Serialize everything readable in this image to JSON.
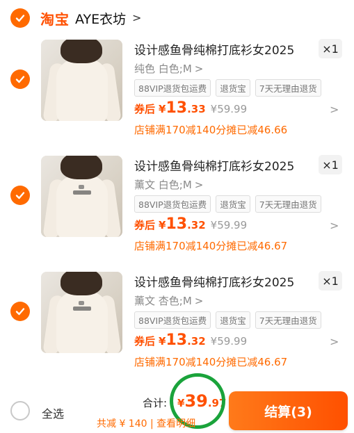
{
  "colors": {
    "accent": "#ff5000",
    "discount": "#ff6a00",
    "highlight_circle": "#1aa33b"
  },
  "store": {
    "brand": "淘宝",
    "name": "AYE衣坊",
    "chevron": ">"
  },
  "items": [
    {
      "title": "设计感鱼骨纯棉打底衫女2025",
      "qty": "×1",
      "variant": "纯色 白色;M",
      "tags": [
        "88VIP退货包运费",
        "退货宝",
        "7天无理由退货"
      ],
      "price_label": "券后",
      "price_symbol": "¥",
      "price_int": "13",
      "price_dec": ".33",
      "price_orig": "¥59.99",
      "discount_note": "店铺满170减140分摊已减46.66",
      "checked": true
    },
    {
      "title": "设计感鱼骨纯棉打底衫女2025",
      "qty": "×1",
      "variant": "薰文 白色;M",
      "tags": [
        "88VIP退货包运费",
        "退货宝",
        "7天无理由退货"
      ],
      "price_label": "券后",
      "price_symbol": "¥",
      "price_int": "13",
      "price_dec": ".32",
      "price_orig": "¥59.99",
      "discount_note": "店铺满170减140分摊已减46.67",
      "checked": true
    },
    {
      "title": "设计感鱼骨纯棉打底衫女2025",
      "qty": "×1",
      "variant": "薰文 杏色;M",
      "tags": [
        "88VIP退货包运费",
        "退货宝",
        "7天无理由退货"
      ],
      "price_label": "券后",
      "price_symbol": "¥",
      "price_int": "13",
      "price_dec": ".32",
      "price_orig": "¥59.99",
      "discount_note": "店铺满170减140分摊已减46.67",
      "checked": true
    }
  ],
  "footer": {
    "select_all": "全选",
    "total_label": "合计:",
    "total_symbol": "¥",
    "total_int": "39",
    "total_dec": ".97",
    "saved_line": "共减 ¥ 140 | 查看明细",
    "checkout": "结算(3)"
  }
}
